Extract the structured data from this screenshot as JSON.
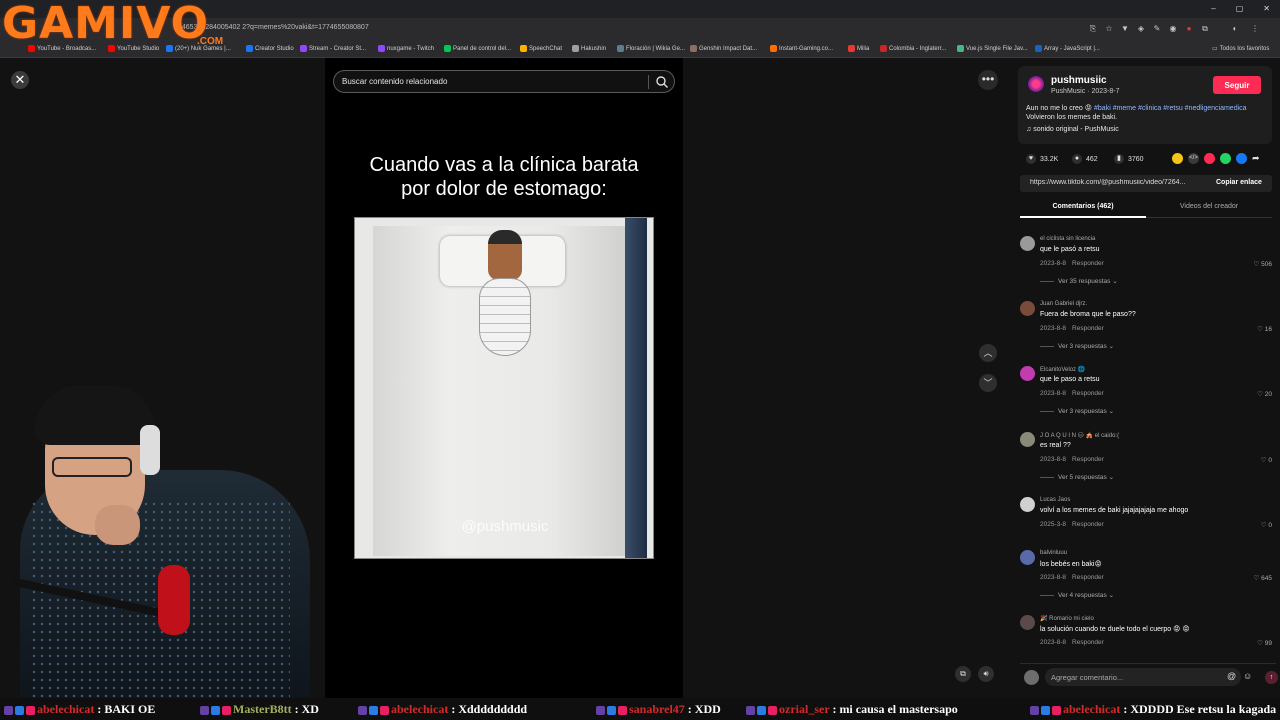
{
  "browser": {
    "url": "6465327284005402 2?q=memes%20vaki&t=1774655080807",
    "bookmarks": [
      {
        "label": "YouTube - Broadcas...",
        "color": "#ff0000"
      },
      {
        "label": "YouTube Studio",
        "color": "#ff0000"
      },
      {
        "label": "(20+) Nuk Games |...",
        "color": "#1877f2"
      },
      {
        "label": "Creator Studio",
        "color": "#1877f2"
      },
      {
        "label": "Stream - Creator St...",
        "color": "#9146ff"
      },
      {
        "label": "nuxgame - Twitch",
        "color": "#9146ff"
      },
      {
        "label": "Panel de control del...",
        "color": "#00c853"
      },
      {
        "label": "SpeechChat",
        "color": "#ffb300"
      },
      {
        "label": "Hakushin",
        "color": "#9e9e9e"
      },
      {
        "label": "Floración | Wikia Ge...",
        "color": "#607d8b"
      },
      {
        "label": "Genshin Impact Dat...",
        "color": "#8d6e63"
      },
      {
        "label": "Instant-Gaming.co...",
        "color": "#ff6f00"
      },
      {
        "label": "Milia",
        "color": "#e53935"
      },
      {
        "label": "Colombia - Inglaterr...",
        "color": "#c62828"
      },
      {
        "label": "Vue.js Single File Jav...",
        "color": "#42b883"
      },
      {
        "label": "Array - JavaScript |...",
        "color": "#1565c0"
      }
    ],
    "bookmarks_folder": "Todos los favoritos"
  },
  "overlay": {
    "logo_text": "GAMIVO",
    "logo_sub": ".COM"
  },
  "video": {
    "search_placeholder": "Buscar contenido relacionado",
    "caption_line1": "Cuando vas a la clínica barata",
    "caption_line2": "por dolor de estomago:",
    "watermark": "@pushmusic"
  },
  "author": {
    "username": "pushmusiic",
    "subline": "PushMusic · 2023-8-7",
    "follow_label": "Seguir",
    "desc_prefix": "Aun no me lo creo 😡",
    "hashtags": "#baki #meme #clinica #retsu #nedligenciamedica",
    "desc_suffix": "Volvieron los memes de baki.",
    "sound": "♫ sonido original - PushMusic"
  },
  "stats": {
    "likes": "33.2K",
    "comments": "462",
    "saves": "3760"
  },
  "share": {
    "link": "https://www.tiktok.com/@pushmusiic/video/7264...",
    "copy_label": "Copiar enlace"
  },
  "tabs": {
    "comments": "Comentarios (462)",
    "videos": "Videos del creador"
  },
  "comments": [
    {
      "user": "el ciclista sin licencia",
      "text": "que le pasó a retsu",
      "date": "2023-8-8",
      "reply": "Responder",
      "likes": "506",
      "replies": "Ver 35 respuestas ⌄",
      "avatar": "#9a9a9a"
    },
    {
      "user": "Juan Gabriel djrz.",
      "text": "Fuera de broma que le paso??",
      "date": "2023-8-8",
      "reply": "Responder",
      "likes": "16",
      "replies": "Ver 3 respuestas ⌄",
      "avatar": "#7a4a3a"
    },
    {
      "user": "ElcanitoVeloz 🌐",
      "text": "que le paso a retsu",
      "date": "2023-8-8",
      "reply": "Responder",
      "likes": "20",
      "replies": "Ver 3 respuestas ⌄",
      "avatar": "#c33bb0"
    },
    {
      "user": "J O A Q U I N 😑 🎪 el caido:(",
      "text": "es real ??",
      "date": "2023-8-8",
      "reply": "Responder",
      "likes": "0",
      "replies": "Ver 5 respuestas ⌄",
      "avatar": "#8a8a7a"
    },
    {
      "user": "Lucas Jaos",
      "text": "volví a los memes de baki jajajajajaja me ahogo",
      "date": "2025-3-8",
      "reply": "Responder",
      "likes": "0",
      "replies": "",
      "avatar": "#d0d0d0"
    },
    {
      "user": "balvinluuu",
      "text": "los bebés en baki😡",
      "date": "2023-8-8",
      "reply": "Responder",
      "likes": "645",
      "replies": "Ver 4 respuestas ⌄",
      "avatar": "#5a6aa8"
    },
    {
      "user": "🎉 Romario mi cielo",
      "text": "la solución cuando te duele todo el cuerpo 😡 😡",
      "date": "2023-8-8",
      "reply": "Responder",
      "likes": "99",
      "replies": "",
      "avatar": "#5a4a4a"
    }
  ],
  "comment_box": {
    "placeholder": "Agregar comentario...",
    "mention": "@",
    "emoji": "☺",
    "post": "↑"
  },
  "chat": [
    {
      "user": "abelechicat",
      "text": "BAKI OE",
      "green": false
    },
    {
      "user": "MasterB8tt",
      "text": "XD",
      "green": true
    },
    {
      "user": "abelechicat",
      "text": "Xddddddddd",
      "green": false
    },
    {
      "user": "sanabrel47",
      "text": "XDD",
      "green": false
    },
    {
      "user": "ozrial_ser",
      "text": "mi causa el mastersapo",
      "green": false
    },
    {
      "user": "abelechicat",
      "text": "XDDDD Ese retsu la kagada",
      "green": false
    }
  ],
  "colors": {
    "accent": "#fe2c55",
    "hashtag": "#8fb8ff",
    "chat_user": "#d42a2a",
    "logo": "#ff7a1a"
  }
}
